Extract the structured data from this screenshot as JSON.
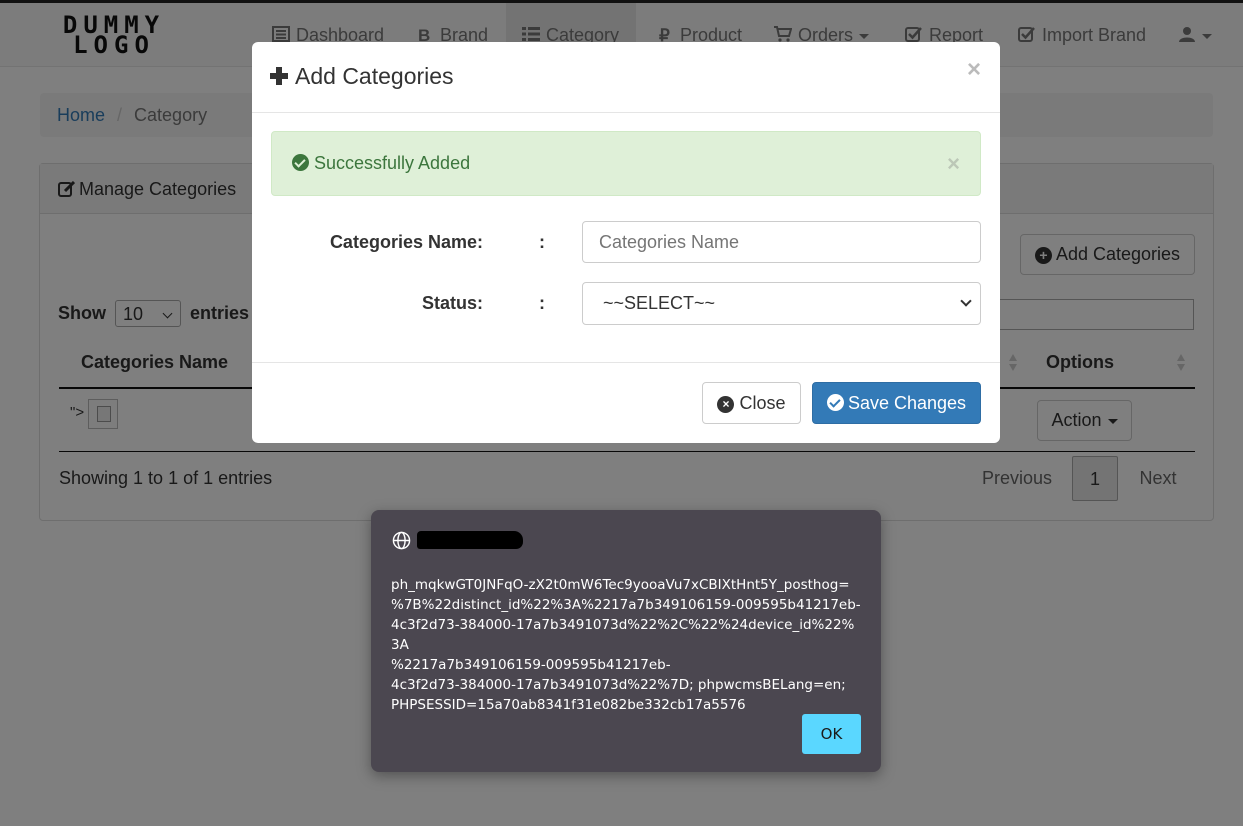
{
  "logo": {
    "line1": "DUMMY",
    "line2": "LOGO"
  },
  "nav": {
    "dashboard": "Dashboard",
    "brand": "Brand",
    "category": "Category",
    "product": "Product",
    "orders": "Orders",
    "report": "Report",
    "import_brand": "Import Brand"
  },
  "breadcrumb": {
    "home": "Home",
    "separator": "/",
    "current": "Category"
  },
  "panel": {
    "title": "Manage Categories",
    "add_button": "Add Categories",
    "show": "Show",
    "entries_value": "10",
    "entries": "entries",
    "columns": {
      "name": "Categories Name",
      "options": "Options"
    },
    "row": {
      "name_text": "\">",
      "action": "Action"
    },
    "info": "Showing 1 to 1 of 1 entries",
    "pager": {
      "previous": "Previous",
      "page": "1",
      "next": "Next"
    }
  },
  "modal": {
    "title": "Add Categories",
    "close_x": "×",
    "alert": {
      "text": "Successfully Added",
      "close_x": "×"
    },
    "fields": {
      "name_label": "Categories Name:",
      "name_placeholder": "Categories Name",
      "status_label": "Status:",
      "status_value": "~~SELECT~~",
      "colon": ":"
    },
    "buttons": {
      "close": "Close",
      "save": "Save Changes"
    }
  },
  "dialog": {
    "message": "ph_mqkwGT0JNFqO-zX2t0mW6Tec9yooaVu7xCBIXtHnt5Y_posthog=\n%7B%22distinct_id%22%3A%2217a7b349106159-009595b41217eb-\n4c3f2d73-384000-17a7b3491073d%22%2C%22%24device_id%22%3A\n%2217a7b349106159-009595b41217eb-\n4c3f2d73-384000-17a7b3491073d%22%7D; phpwcmsBELang=en;\nPHPSESSID=15a70ab8341f31e082be332cb17a5576",
    "ok": "OK"
  },
  "colors": {
    "primary": "#337ab7",
    "success_bg": "#dff0d8",
    "success_text": "#3c763d",
    "dialog_bg": "#4b4750",
    "dialog_ok": "#5ad7ff"
  }
}
